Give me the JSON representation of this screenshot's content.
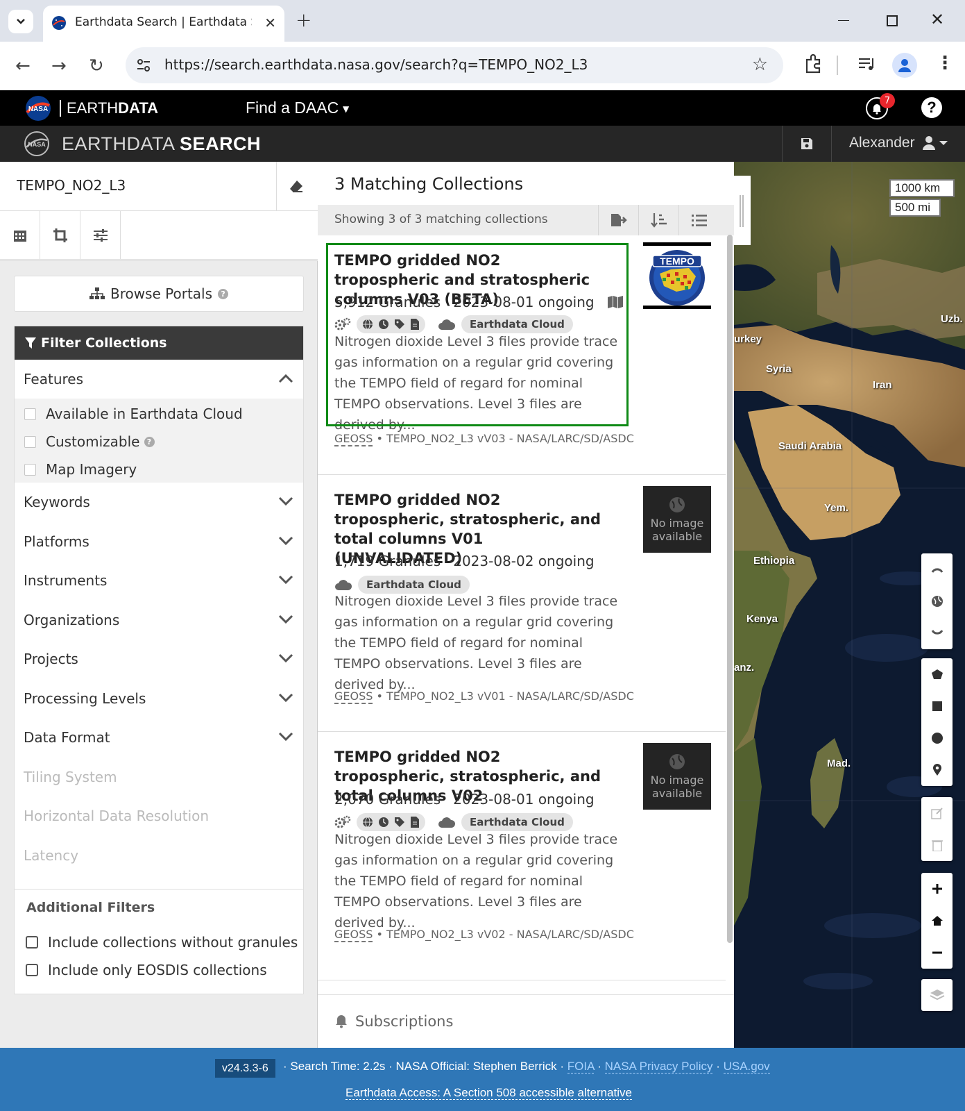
{
  "browser": {
    "tab_title": "Earthdata Search | Earthdata Se",
    "url": "https://search.earthdata.nasa.gov/search?q=TEMPO_NO2_L3"
  },
  "ed_header": {
    "brand_light": "EARTH",
    "brand_bold": "DATA",
    "find_daac": "Find a DAAC",
    "notifications_count": "7",
    "help": "?"
  },
  "eds_header": {
    "title_light": "EARTHDATA ",
    "title_bold": "SEARCH",
    "user": "Alexander"
  },
  "sidebar": {
    "search_value": "TEMPO_NO2_L3",
    "browse_portals": "Browse Portals",
    "filter_header": "Filter Collections",
    "features_label": "Features",
    "features": [
      {
        "label": "Available in Earthdata Cloud",
        "checked": false
      },
      {
        "label": "Customizable",
        "checked": false
      },
      {
        "label": "Map Imagery",
        "checked": false
      }
    ],
    "facets": [
      {
        "label": "Keywords",
        "enabled": true
      },
      {
        "label": "Platforms",
        "enabled": true
      },
      {
        "label": "Instruments",
        "enabled": true
      },
      {
        "label": "Organizations",
        "enabled": true
      },
      {
        "label": "Projects",
        "enabled": true
      },
      {
        "label": "Processing Levels",
        "enabled": true
      },
      {
        "label": "Data Format",
        "enabled": true
      },
      {
        "label": "Tiling System",
        "enabled": false
      },
      {
        "label": "Horizontal Data Resolution",
        "enabled": false
      },
      {
        "label": "Latency",
        "enabled": false
      }
    ],
    "additional_filters_title": "Additional Filters",
    "additional_filters": [
      {
        "label": "Include collections without granules",
        "checked": false
      },
      {
        "label": "Include only EOSDIS collections",
        "checked": false
      }
    ]
  },
  "results": {
    "title": "3 Matching Collections",
    "showing": "Showing 3 of 3 matching collections",
    "cards": [
      {
        "title": "TEMPO gridded NO2 tropospheric and stratospheric columns V03 (BETA)",
        "granules": "5,912 Granules",
        "dates": "2023-08-01 ongoing",
        "cloud_label": "Earthdata Cloud",
        "description": "Nitrogen dioxide Level 3 files provide trace gas information on a regular grid covering the TEMPO field of regard for nominal TEMPO observations. Level 3 files are derived by...",
        "footer_geoss": "GEOSS",
        "footer_rest": " • TEMPO_NO2_L3 vV03 - NASA/LARC/SD/ASDC",
        "thumbnail": "TEMPO"
      },
      {
        "title": "TEMPO gridded NO2 tropospheric, stratospheric, and total columns V01 (UNVALIDATED)",
        "granules": "1,719 Granules",
        "dates": "2023-08-02 ongoing",
        "cloud_label": "Earthdata Cloud",
        "description": "Nitrogen dioxide Level 3 files provide trace gas information on a regular grid covering the TEMPO field of regard for nominal TEMPO observations. Level 3 files are derived by...",
        "footer_geoss": "GEOSS",
        "footer_rest": " • TEMPO_NO2_L3 vV01 - NASA/LARC/SD/ASDC",
        "no_image": "No image available"
      },
      {
        "title": "TEMPO gridded NO2 tropospheric, stratospheric, and total columns V02",
        "granules": "2,070 Granules",
        "dates": "2023-08-01 ongoing",
        "cloud_label": "Earthdata Cloud",
        "description": "Nitrogen dioxide Level 3 files provide trace gas information on a regular grid covering the TEMPO field of regard for nominal TEMPO observations. Level 3 files are derived by...",
        "footer_geoss": "GEOSS",
        "footer_rest": " • TEMPO_NO2_L3 vV02 - NASA/LARC/SD/ASDC",
        "no_image": "No image available"
      }
    ],
    "subscriptions": "Subscriptions"
  },
  "map": {
    "scale_km": "1000 km",
    "scale_mi": "500 mi",
    "labels": [
      "urkey",
      "Uzb.",
      "Syria",
      "Iran",
      "Saudi Arabia",
      "Yem.",
      "Ethiopia",
      "Kenya",
      "anz.",
      "Mad."
    ]
  },
  "footer": {
    "version": "v24.3.3-6",
    "search_time": "Search Time: 2.2s",
    "official": "NASA Official: Stephen Berrick",
    "foia": "FOIA",
    "privacy": "NASA Privacy Policy",
    "usagov": "USA.gov",
    "accessible": "Earthdata Access: A Section 508 accessible alternative"
  },
  "colors": {
    "highlight": "#0f8a16",
    "footer_bg": "#2f77b7",
    "header_bg": "#000000"
  }
}
